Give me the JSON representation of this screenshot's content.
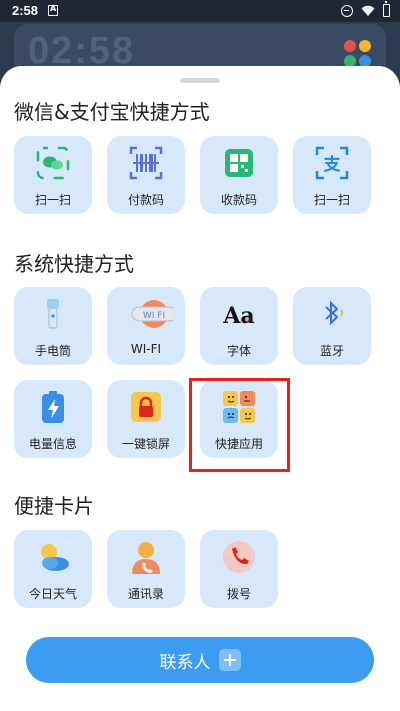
{
  "status_bar": {
    "time": "2:58"
  },
  "background_widget": {
    "clock": "02:58"
  },
  "sections": [
    {
      "title": "微信&支付宝快捷方式"
    },
    {
      "title": "系统快捷方式"
    },
    {
      "title": "便捷卡片"
    }
  ],
  "wechat_alipay_items": [
    {
      "label": "扫一扫",
      "icon": "wechat-scan-icon"
    },
    {
      "label": "付款码",
      "icon": "barcode-icon"
    },
    {
      "label": "收款码",
      "icon": "qr-collect-icon"
    },
    {
      "label": "扫一扫",
      "icon": "alipay-scan-icon"
    }
  ],
  "system_items": [
    {
      "label": "手电筒",
      "icon": "flashlight-icon"
    },
    {
      "label": "WI-FI",
      "icon": "wifi-icon"
    },
    {
      "label": "字体",
      "icon": "font-icon"
    },
    {
      "label": "蓝牙",
      "icon": "bluetooth-icon"
    },
    {
      "label": "电量信息",
      "icon": "battery-icon"
    },
    {
      "label": "一键锁屏",
      "icon": "lock-icon"
    },
    {
      "label": "快捷应用",
      "icon": "emoji-grid-icon"
    }
  ],
  "card_items": [
    {
      "label": "今日天气",
      "icon": "weather-icon"
    },
    {
      "label": "通讯录",
      "icon": "contacts-icon"
    },
    {
      "label": "拨号",
      "icon": "phone-icon"
    }
  ],
  "contact_button": {
    "label": "联系人"
  },
  "icon_text": {
    "wifi": "WI FI",
    "font": "Aa"
  },
  "colors": {
    "accent": "#3b9cf2",
    "tile_bg": "#d8e8fb",
    "highlight": "#e0241f"
  }
}
